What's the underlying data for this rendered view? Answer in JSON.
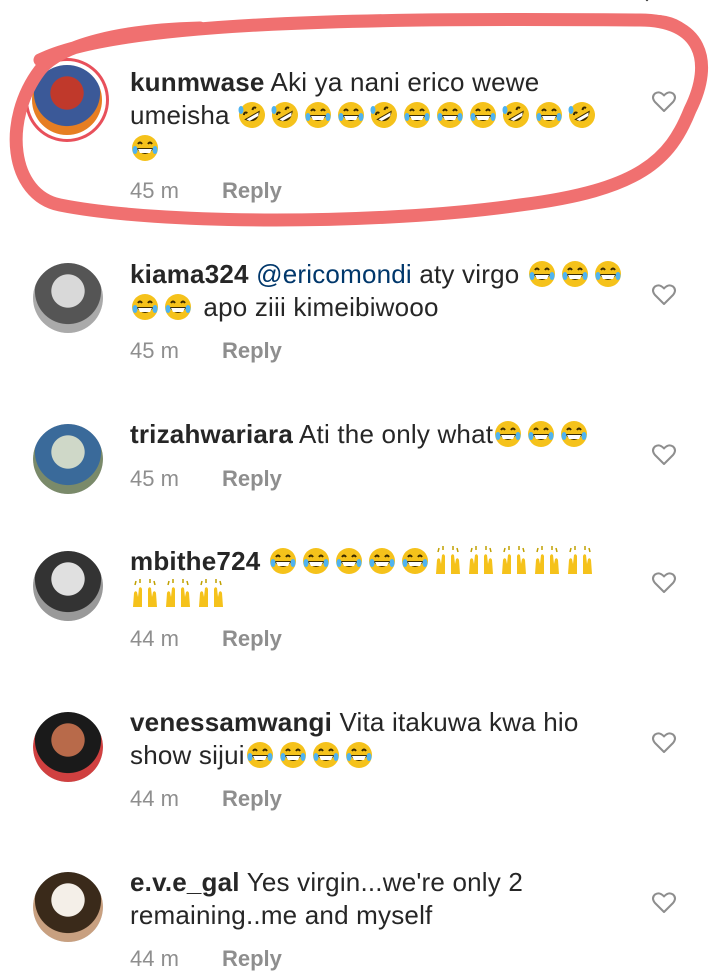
{
  "comments": [
    {
      "username": "kunmwase",
      "mention": "",
      "text": " Aki ya nani erico wewe umeisha ",
      "emojis": [
        "rofl",
        "rofl",
        "grin",
        "grin",
        "rofl",
        "grin",
        "grin",
        "grin",
        "rofl",
        "grin",
        "rofl",
        "grin"
      ],
      "text_after": "",
      "time": "45 m",
      "reply_label": "Reply",
      "has_story_ring": true,
      "highlighted": true,
      "avatar_colors": [
        "#c0392b",
        "#3b5998",
        "#e67e22"
      ]
    },
    {
      "username": "kiama324",
      "mention": "@ericomondi",
      "text": "  aty virgo ",
      "emojis": [
        "grin",
        "grin",
        "grin",
        "grin",
        "grin"
      ],
      "text_after": " apo ziii kimeibiwooo",
      "time": "45 m",
      "reply_label": "Reply",
      "has_story_ring": false,
      "highlighted": false,
      "avatar_colors": [
        "#d9d9d9",
        "#555555",
        "#aaaaaa"
      ]
    },
    {
      "username": "trizahwariara",
      "mention": "",
      "text": " Ati the only what",
      "emojis": [
        "grin",
        "grin",
        "grin"
      ],
      "text_after": "",
      "time": "45 m",
      "reply_label": "Reply",
      "has_story_ring": false,
      "highlighted": false,
      "avatar_colors": [
        "#cfd8c8",
        "#3a6a9a",
        "#7a8a6a"
      ]
    },
    {
      "username": "mbithe724",
      "mention": "",
      "text": " ",
      "emojis": [
        "grin",
        "grin",
        "grin",
        "grin",
        "grin",
        "hands",
        "hands",
        "hands",
        "hands",
        "hands",
        "hands",
        "hands",
        "hands"
      ],
      "text_after": "",
      "time": "44 m",
      "reply_label": "Reply",
      "has_story_ring": false,
      "highlighted": false,
      "avatar_colors": [
        "#e0e0e0",
        "#333333",
        "#999999"
      ]
    },
    {
      "username": "venessamwangi",
      "mention": "",
      "text": " Vita itakuwa kwa hio show sijui",
      "emojis": [
        "grin",
        "grin",
        "grin",
        "grin"
      ],
      "text_after": "",
      "time": "44 m",
      "reply_label": "Reply",
      "has_story_ring": false,
      "highlighted": false,
      "avatar_colors": [
        "#b86a4a",
        "#1a1a1a",
        "#d04040"
      ]
    },
    {
      "username": "e.v.e_gal",
      "mention": "",
      "text": " Yes  virgin...we're only 2 remaining..me and myself",
      "emojis": [],
      "text_after": "",
      "time": "44 m",
      "reply_label": "Reply",
      "has_story_ring": false,
      "highlighted": false,
      "avatar_colors": [
        "#f4efe8",
        "#3a2a1a",
        "#c8a080"
      ]
    }
  ],
  "colors": {
    "username": "#262626",
    "mention": "#00376b",
    "meta": "#8e8e8e",
    "highlight": "#f07070"
  },
  "icons": {
    "like": "heart-outline-icon",
    "top": "chevron-down-icon"
  }
}
